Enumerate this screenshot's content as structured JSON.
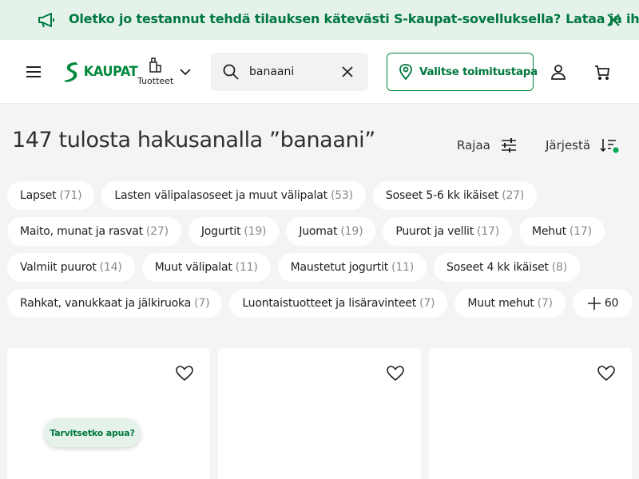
{
  "promo": {
    "text": "Oletko jo testannut tehdä tilauksen kätevästi S-kaupat-sovelluksella?",
    "cta": "Lataa ja ihastu"
  },
  "header": {
    "logo_text": "KAUPAT",
    "products_label": "Tuotteet",
    "search_value": "banaani",
    "delivery_label": "Valitse toimitustapa"
  },
  "results": {
    "title": "147 tulosta hakusanalla ”banaani”",
    "filter_label": "Rajaa",
    "sort_label": "Järjestä"
  },
  "chips": {
    "row1": [
      {
        "label": "Lapset",
        "count": "(71)"
      },
      {
        "label": "Lasten välipalasoseet ja muut välipalat",
        "count": "(53)"
      },
      {
        "label": "Soseet 5-6 kk ikäiset",
        "count": "(27)"
      }
    ],
    "row2": [
      {
        "label": "Maito, munat ja rasvat",
        "count": "(27)"
      },
      {
        "label": "Jogurtit",
        "count": "(19)"
      },
      {
        "label": "Juomat",
        "count": "(19)"
      },
      {
        "label": "Puurot ja vellit",
        "count": "(17)"
      },
      {
        "label": "Mehut",
        "count": "(17)"
      }
    ],
    "row3": [
      {
        "label": "Valmiit puurot",
        "count": "(14)"
      },
      {
        "label": "Muut välipalat",
        "count": "(11)"
      },
      {
        "label": "Maustetut jogurtit",
        "count": "(11)"
      },
      {
        "label": "Soseet 4 kk ikäiset",
        "count": "(8)"
      }
    ],
    "row4": [
      {
        "label": "Rahkat, vanukkaat ja jälkiruoka",
        "count": "(7)"
      },
      {
        "label": "Luontaistuotteet ja lisäravinteet",
        "count": "(7)"
      },
      {
        "label": "Muut mehut",
        "count": "(7)"
      }
    ],
    "more_label": "60"
  },
  "help": {
    "label": "Tarvitsetko apua?"
  },
  "colors": {
    "brand_green": "#00893c",
    "banner_bg": "#e5f2ea",
    "page_bg": "#f4f4f4"
  },
  "icons": [
    "megaphone-icon",
    "close-icon",
    "hamburger-icon",
    "shopping-bag-icon",
    "chevron-down-icon",
    "search-icon",
    "clear-icon",
    "location-pin-icon",
    "user-icon",
    "cart-icon",
    "filter-sliders-icon",
    "sort-icon",
    "plus-icon",
    "heart-icon"
  ]
}
